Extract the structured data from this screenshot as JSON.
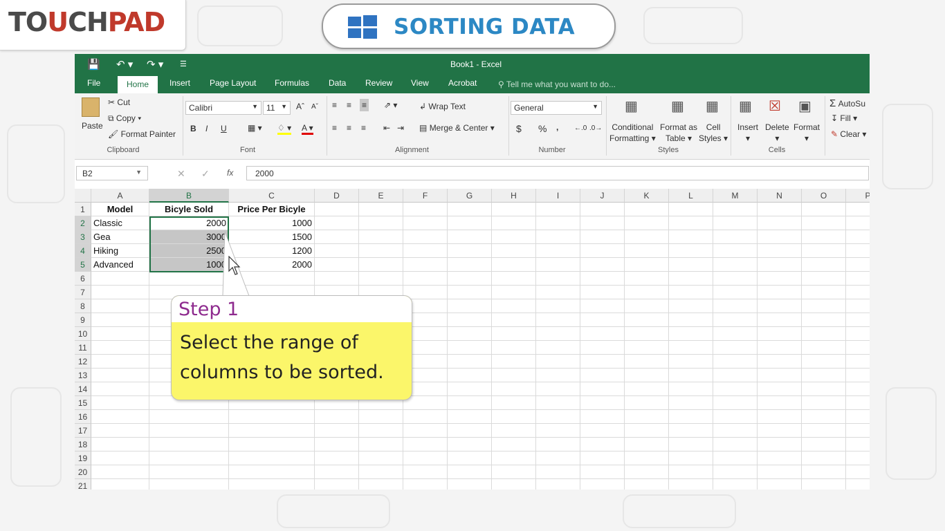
{
  "brand": {
    "logo_text": "TOUCHPAD"
  },
  "title": {
    "text": "SORTING DATA"
  },
  "excel": {
    "window_title": "Book1 - Excel",
    "tabs": [
      "File",
      "Home",
      "Insert",
      "Page Layout",
      "Formulas",
      "Data",
      "Review",
      "View",
      "Acrobat"
    ],
    "active_tab": "Home",
    "tell_me": "Tell me what you want to do...",
    "ribbon": {
      "clipboard": {
        "paste": "Paste",
        "cut": "Cut",
        "copy": "Copy",
        "format_painter": "Format Painter",
        "label": "Clipboard"
      },
      "font": {
        "name": "Calibri",
        "size": "11",
        "bold": "B",
        "italic": "I",
        "underline": "U",
        "label": "Font"
      },
      "alignment": {
        "wrap_text": "Wrap Text",
        "merge_center": "Merge & Center",
        "label": "Alignment"
      },
      "number": {
        "format": "General",
        "currency": "$",
        "percent": "%",
        "comma": ",",
        "label": "Number"
      },
      "styles": {
        "conditional": "Conditional",
        "formatting": "Formatting",
        "format_as": "Format as",
        "table": "Table",
        "cell": "Cell",
        "cell_styles": "Styles",
        "label": "Styles"
      },
      "cells": {
        "insert": "Insert",
        "delete": "Delete",
        "format": "Format",
        "label": "Cells"
      },
      "editing": {
        "autosum": "AutoSu",
        "fill": "Fill",
        "clear": "Clear"
      }
    },
    "name_box": "B2",
    "formula_value": "2000",
    "columns": [
      "A",
      "B",
      "C",
      "D",
      "E",
      "F",
      "G",
      "H",
      "I",
      "J",
      "K",
      "L",
      "M",
      "N",
      "O",
      "P"
    ],
    "rows": [
      "1",
      "2",
      "3",
      "4",
      "5",
      "6",
      "7",
      "8",
      "9",
      "10",
      "11",
      "12",
      "13",
      "14",
      "15",
      "16",
      "17",
      "18",
      "19",
      "20",
      "21"
    ],
    "table": {
      "headers": [
        "Model",
        "Bicyle Sold",
        "Price Per Bicyle"
      ],
      "data": [
        [
          "Classic",
          "2000",
          "1000"
        ],
        [
          "Gea",
          "3000",
          "1500"
        ],
        [
          "Hiking",
          "2500",
          "1200"
        ],
        [
          "Advanced",
          "1000",
          "2000"
        ]
      ]
    }
  },
  "callout": {
    "step": "Step 1",
    "text": "Select the range of columns to be sorted."
  },
  "colors": {
    "excel_green": "#217346",
    "callout_yellow": "#fbf66a",
    "step_purple": "#8e2a8e",
    "title_blue": "#2c88c4",
    "brand_red": "#c0392b"
  }
}
